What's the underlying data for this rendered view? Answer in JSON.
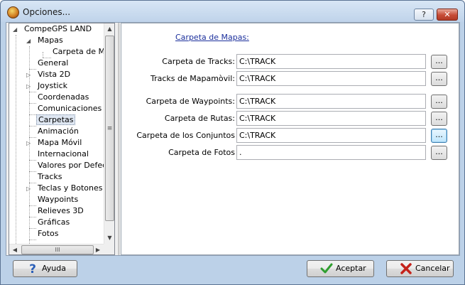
{
  "window": {
    "title": "Opciones...",
    "help_glyph": "?",
    "close_glyph": "✕"
  },
  "tree": {
    "items": [
      {
        "label": "CompeGPS LAND",
        "expander": "◢"
      },
      {
        "label": "Mapas",
        "expander": "◢"
      },
      {
        "label": "Carpeta de Ma"
      },
      {
        "label": "General"
      },
      {
        "label": "Vista 2D",
        "expander": "▷"
      },
      {
        "label": "Joystick",
        "expander": "▷"
      },
      {
        "label": "Coordenadas"
      },
      {
        "label": "Comunicaciones"
      },
      {
        "label": "Carpetas",
        "selected": true
      },
      {
        "label": "Animación"
      },
      {
        "label": "Mapa Móvil",
        "expander": "▷"
      },
      {
        "label": "Internacional"
      },
      {
        "label": "Valores por Defect"
      },
      {
        "label": "Tracks"
      },
      {
        "label": "Teclas y Botones",
        "expander": "▷"
      },
      {
        "label": "Waypoints"
      },
      {
        "label": "Relieves 3D"
      },
      {
        "label": "Gráficas"
      },
      {
        "label": "Fotos"
      }
    ],
    "scroll": {
      "up": "▲",
      "down": "▼",
      "grip": "≡",
      "left": "◀",
      "right": "▶",
      "hgrip": "III"
    }
  },
  "panel": {
    "section_title": "Carpeta de Mapas:",
    "fields": [
      {
        "label": "Carpeta de Tracks:",
        "value": "C:\\TRACK",
        "button": "..."
      },
      {
        "label": "Tracks de Mapamòvil:",
        "value": "C:\\TRACK",
        "button": "..."
      },
      {
        "label": "Carpeta de Waypoints:",
        "value": "C:\\TRACK",
        "button": "..."
      },
      {
        "label": "Carpeta de Rutas:",
        "value": "C:\\TRACK",
        "button": "..."
      },
      {
        "label": "Carpeta de los Conjuntos",
        "value": "C:\\TRACK",
        "button": "..."
      },
      {
        "label": "Carpeta de Fotos",
        "value": ".",
        "button": "..."
      }
    ]
  },
  "buttons": {
    "help": "Ayuda",
    "accept": "Aceptar",
    "cancel": "Cancelar"
  },
  "colors": {
    "link": "#1b2f9c",
    "accept_icon": "#2f9e2f",
    "cancel_icon": "#c4221b",
    "help_icon": "#2a5fb8"
  }
}
